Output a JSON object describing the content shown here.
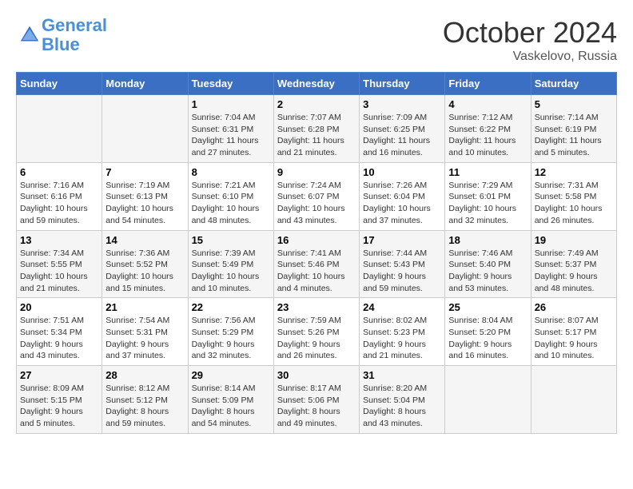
{
  "header": {
    "logo_line1": "General",
    "logo_line2": "Blue",
    "month": "October 2024",
    "location": "Vaskelovo, Russia"
  },
  "days_of_week": [
    "Sunday",
    "Monday",
    "Tuesday",
    "Wednesday",
    "Thursday",
    "Friday",
    "Saturday"
  ],
  "weeks": [
    [
      {
        "num": "",
        "detail": ""
      },
      {
        "num": "",
        "detail": ""
      },
      {
        "num": "1",
        "detail": "Sunrise: 7:04 AM\nSunset: 6:31 PM\nDaylight: 11 hours and 27 minutes."
      },
      {
        "num": "2",
        "detail": "Sunrise: 7:07 AM\nSunset: 6:28 PM\nDaylight: 11 hours and 21 minutes."
      },
      {
        "num": "3",
        "detail": "Sunrise: 7:09 AM\nSunset: 6:25 PM\nDaylight: 11 hours and 16 minutes."
      },
      {
        "num": "4",
        "detail": "Sunrise: 7:12 AM\nSunset: 6:22 PM\nDaylight: 11 hours and 10 minutes."
      },
      {
        "num": "5",
        "detail": "Sunrise: 7:14 AM\nSunset: 6:19 PM\nDaylight: 11 hours and 5 minutes."
      }
    ],
    [
      {
        "num": "6",
        "detail": "Sunrise: 7:16 AM\nSunset: 6:16 PM\nDaylight: 10 hours and 59 minutes."
      },
      {
        "num": "7",
        "detail": "Sunrise: 7:19 AM\nSunset: 6:13 PM\nDaylight: 10 hours and 54 minutes."
      },
      {
        "num": "8",
        "detail": "Sunrise: 7:21 AM\nSunset: 6:10 PM\nDaylight: 10 hours and 48 minutes."
      },
      {
        "num": "9",
        "detail": "Sunrise: 7:24 AM\nSunset: 6:07 PM\nDaylight: 10 hours and 43 minutes."
      },
      {
        "num": "10",
        "detail": "Sunrise: 7:26 AM\nSunset: 6:04 PM\nDaylight: 10 hours and 37 minutes."
      },
      {
        "num": "11",
        "detail": "Sunrise: 7:29 AM\nSunset: 6:01 PM\nDaylight: 10 hours and 32 minutes."
      },
      {
        "num": "12",
        "detail": "Sunrise: 7:31 AM\nSunset: 5:58 PM\nDaylight: 10 hours and 26 minutes."
      }
    ],
    [
      {
        "num": "13",
        "detail": "Sunrise: 7:34 AM\nSunset: 5:55 PM\nDaylight: 10 hours and 21 minutes."
      },
      {
        "num": "14",
        "detail": "Sunrise: 7:36 AM\nSunset: 5:52 PM\nDaylight: 10 hours and 15 minutes."
      },
      {
        "num": "15",
        "detail": "Sunrise: 7:39 AM\nSunset: 5:49 PM\nDaylight: 10 hours and 10 minutes."
      },
      {
        "num": "16",
        "detail": "Sunrise: 7:41 AM\nSunset: 5:46 PM\nDaylight: 10 hours and 4 minutes."
      },
      {
        "num": "17",
        "detail": "Sunrise: 7:44 AM\nSunset: 5:43 PM\nDaylight: 9 hours and 59 minutes."
      },
      {
        "num": "18",
        "detail": "Sunrise: 7:46 AM\nSunset: 5:40 PM\nDaylight: 9 hours and 53 minutes."
      },
      {
        "num": "19",
        "detail": "Sunrise: 7:49 AM\nSunset: 5:37 PM\nDaylight: 9 hours and 48 minutes."
      }
    ],
    [
      {
        "num": "20",
        "detail": "Sunrise: 7:51 AM\nSunset: 5:34 PM\nDaylight: 9 hours and 43 minutes."
      },
      {
        "num": "21",
        "detail": "Sunrise: 7:54 AM\nSunset: 5:31 PM\nDaylight: 9 hours and 37 minutes."
      },
      {
        "num": "22",
        "detail": "Sunrise: 7:56 AM\nSunset: 5:29 PM\nDaylight: 9 hours and 32 minutes."
      },
      {
        "num": "23",
        "detail": "Sunrise: 7:59 AM\nSunset: 5:26 PM\nDaylight: 9 hours and 26 minutes."
      },
      {
        "num": "24",
        "detail": "Sunrise: 8:02 AM\nSunset: 5:23 PM\nDaylight: 9 hours and 21 minutes."
      },
      {
        "num": "25",
        "detail": "Sunrise: 8:04 AM\nSunset: 5:20 PM\nDaylight: 9 hours and 16 minutes."
      },
      {
        "num": "26",
        "detail": "Sunrise: 8:07 AM\nSunset: 5:17 PM\nDaylight: 9 hours and 10 minutes."
      }
    ],
    [
      {
        "num": "27",
        "detail": "Sunrise: 8:09 AM\nSunset: 5:15 PM\nDaylight: 9 hours and 5 minutes."
      },
      {
        "num": "28",
        "detail": "Sunrise: 8:12 AM\nSunset: 5:12 PM\nDaylight: 8 hours and 59 minutes."
      },
      {
        "num": "29",
        "detail": "Sunrise: 8:14 AM\nSunset: 5:09 PM\nDaylight: 8 hours and 54 minutes."
      },
      {
        "num": "30",
        "detail": "Sunrise: 8:17 AM\nSunset: 5:06 PM\nDaylight: 8 hours and 49 minutes."
      },
      {
        "num": "31",
        "detail": "Sunrise: 8:20 AM\nSunset: 5:04 PM\nDaylight: 8 hours and 43 minutes."
      },
      {
        "num": "",
        "detail": ""
      },
      {
        "num": "",
        "detail": ""
      }
    ]
  ]
}
